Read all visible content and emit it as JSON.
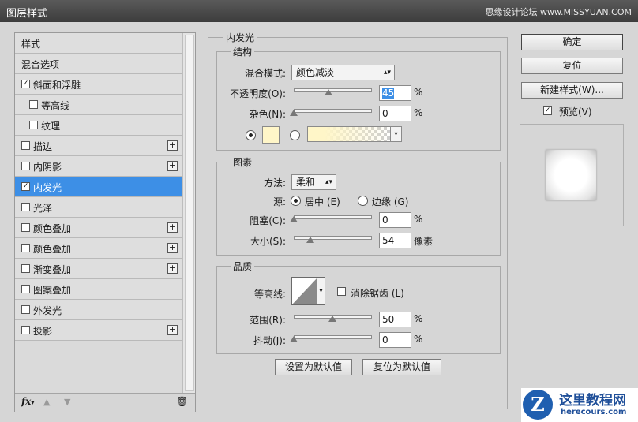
{
  "window": {
    "title": "图层样式",
    "watermark": "思缘设计论坛 www.MISSYUAN.COM"
  },
  "styles_list": [
    {
      "label": "样式",
      "checkbox": false,
      "checked": false,
      "plus": false,
      "indent": 0,
      "selected": false
    },
    {
      "label": "混合选项",
      "checkbox": false,
      "checked": false,
      "plus": false,
      "indent": 0,
      "selected": false
    },
    {
      "label": "斜面和浮雕",
      "checkbox": true,
      "checked": true,
      "plus": false,
      "indent": 0,
      "selected": false
    },
    {
      "label": "等高线",
      "checkbox": true,
      "checked": false,
      "plus": false,
      "indent": 1,
      "selected": false
    },
    {
      "label": "纹理",
      "checkbox": true,
      "checked": false,
      "plus": false,
      "indent": 1,
      "selected": false
    },
    {
      "label": "描边",
      "checkbox": true,
      "checked": false,
      "plus": true,
      "indent": 0,
      "selected": false
    },
    {
      "label": "内阴影",
      "checkbox": true,
      "checked": false,
      "plus": true,
      "indent": 0,
      "selected": false
    },
    {
      "label": "内发光",
      "checkbox": true,
      "checked": true,
      "plus": false,
      "indent": 0,
      "selected": true
    },
    {
      "label": "光泽",
      "checkbox": true,
      "checked": false,
      "plus": false,
      "indent": 0,
      "selected": false
    },
    {
      "label": "颜色叠加",
      "checkbox": true,
      "checked": false,
      "plus": true,
      "indent": 0,
      "selected": false
    },
    {
      "label": "颜色叠加",
      "checkbox": true,
      "checked": false,
      "plus": true,
      "indent": 0,
      "selected": false
    },
    {
      "label": "渐变叠加",
      "checkbox": true,
      "checked": false,
      "plus": true,
      "indent": 0,
      "selected": false
    },
    {
      "label": "图案叠加",
      "checkbox": true,
      "checked": false,
      "plus": false,
      "indent": 0,
      "selected": false
    },
    {
      "label": "外发光",
      "checkbox": true,
      "checked": false,
      "plus": false,
      "indent": 0,
      "selected": false
    },
    {
      "label": "投影",
      "checkbox": true,
      "checked": false,
      "plus": true,
      "indent": 0,
      "selected": false
    }
  ],
  "bottom_bar": {
    "fx_label": "fx",
    "fx_arrow": "▾",
    "up_icon": "▲",
    "down_icon": "▼",
    "trash_icon": "🗑"
  },
  "inner_glow": {
    "title": "内发光",
    "structure": {
      "title": "结构",
      "blend_mode_label": "混合模式:",
      "blend_mode_value": "颜色减淡",
      "opacity_label": "不透明度(O):",
      "opacity_value": "45",
      "opacity_level": 45,
      "opacity_unit": "%",
      "noise_label": "杂色(N):",
      "noise_value": "0",
      "noise_level": 0,
      "noise_unit": "%",
      "glow_color": "#fff6c8"
    },
    "elements": {
      "title": "图素",
      "method_label": "方法:",
      "method_value": "柔和",
      "source_label": "源:",
      "source_center": "居中 (E)",
      "source_edge": "边缘 (G)",
      "choke_label": "阻塞(C):",
      "choke_value": "0",
      "choke_level": 0,
      "choke_unit": "%",
      "size_label": "大小(S):",
      "size_value": "54",
      "size_level": 22,
      "size_unit": "像素"
    },
    "quality": {
      "title": "品质",
      "contour_label": "等高线:",
      "anti_alias_label": "消除锯齿 (L)",
      "range_label": "范围(R):",
      "range_value": "50",
      "range_level": 50,
      "range_unit": "%",
      "jitter_label": "抖动(J):",
      "jitter_value": "0",
      "jitter_level": 0,
      "jitter_unit": "%"
    },
    "set_default": "设置为默认值",
    "reset_default": "复位为默认值"
  },
  "buttons": {
    "ok": "确定",
    "reset": "复位",
    "new_style": "新建样式(W)...",
    "preview_label": "预览(V)",
    "preview_checked": true
  },
  "logo": {
    "title": "这里教程网",
    "url_text": "herecours.com",
    "mark": "Z"
  }
}
